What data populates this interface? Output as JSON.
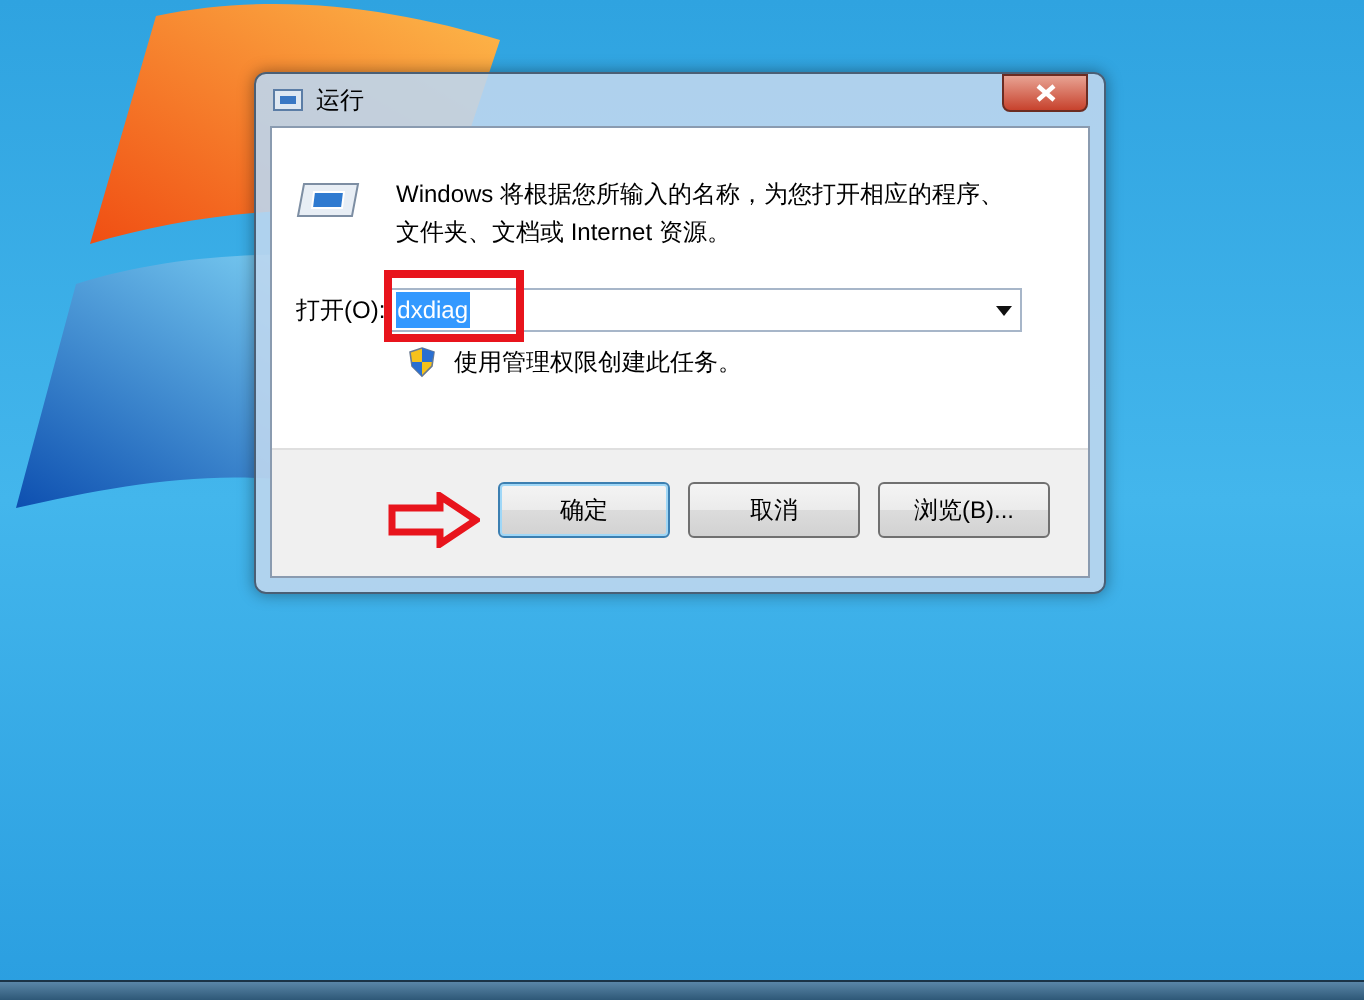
{
  "dialog": {
    "title": "运行",
    "message": "Windows 将根据您所输入的名称，为您打开相应的程序、文件夹、文档或 Internet 资源。",
    "open_label": "打开(O):",
    "open_field": {
      "value": "dxdiag",
      "selected": true
    },
    "admin_note": "使用管理权限创建此任务。",
    "buttons": [
      {
        "label": "确定",
        "default": true
      },
      {
        "label": "取消",
        "default": false
      },
      {
        "label": "浏览(B)...",
        "default": false
      }
    ]
  },
  "annotations": {
    "highlight_field": true,
    "arrow_to_button": true
  }
}
